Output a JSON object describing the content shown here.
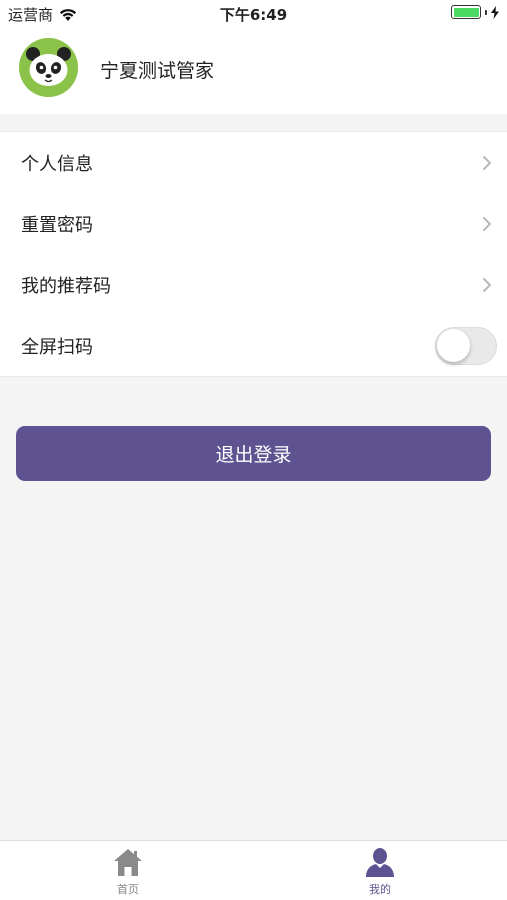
{
  "status_bar": {
    "carrier": "运营商",
    "time": "下午6:49"
  },
  "profile": {
    "name": "宁夏测试管家",
    "avatar_icon": "panda-avatar-icon"
  },
  "menu": {
    "items": [
      {
        "label": "个人信息",
        "control": "chevron-right-icon"
      },
      {
        "label": "重置密码",
        "control": "chevron-right-icon"
      },
      {
        "label": "我的推荐码",
        "control": "chevron-right-icon"
      },
      {
        "label": "全屏扫码",
        "control": "toggle",
        "toggle_on": false
      }
    ]
  },
  "logout_label": "退出登录",
  "tabbar": {
    "tabs": [
      {
        "label": "首页",
        "icon": "home-icon",
        "active": false
      },
      {
        "label": "我的",
        "icon": "person-icon",
        "active": true
      }
    ]
  },
  "colors": {
    "accent": "#5e5390",
    "battery": "#4cd964",
    "avatar_bg": "#8bc34a",
    "page_bg": "#f4f4f4",
    "inactive_tab": "#888888"
  }
}
